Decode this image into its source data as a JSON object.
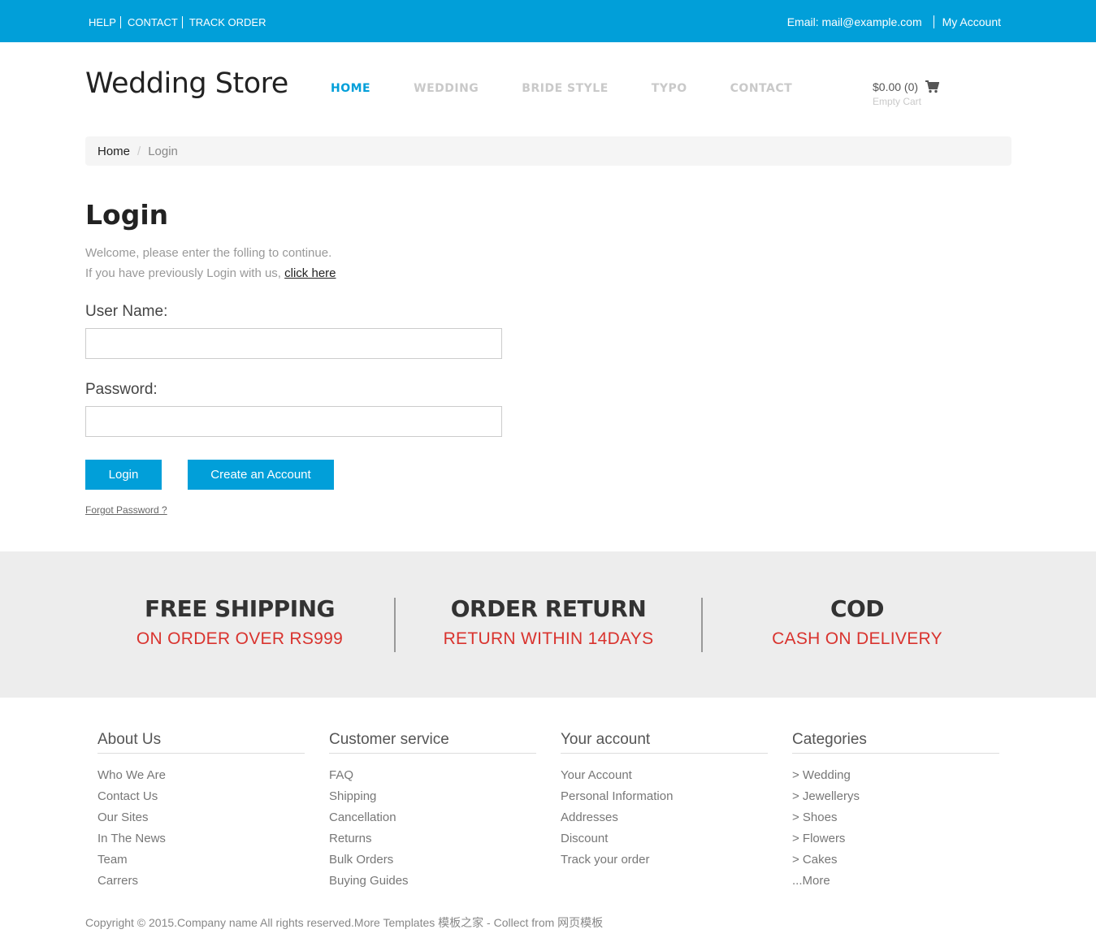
{
  "topbar": {
    "links": [
      "HELP",
      "CONTACT",
      "TRACK ORDER"
    ],
    "email": "Email: mail@example.com",
    "account": "My Account"
  },
  "header": {
    "logo": "Wedding Store",
    "nav": [
      "HOME",
      "WEDDING",
      "BRIDE STYLE",
      "TYPO",
      "CONTACT"
    ],
    "cart_amount": "$0.00 (0)",
    "cart_status": "Empty Cart",
    "cart_icon": "shopping-cart-icon"
  },
  "breadcrumb": {
    "home": "Home",
    "divider": "/",
    "current": "Login"
  },
  "login": {
    "title": "Login",
    "welcome_line1": "Welcome, please enter the folling to continue.",
    "welcome_line2": "If you have previously Login with us,",
    "click_here": "click here",
    "username_label": "User Name:",
    "username_value": "",
    "password_label": "Password:",
    "password_value": "",
    "login_button": "Login",
    "create_button": "Create an Account",
    "forgot": "Forgot Password ?"
  },
  "features": [
    {
      "title": "FREE SHIPPING",
      "subtitle": "ON ORDER OVER RS999"
    },
    {
      "title": "ORDER RETURN",
      "subtitle": "RETURN WITHIN 14DAYS"
    },
    {
      "title": "COD",
      "subtitle": "CASH ON DELIVERY"
    }
  ],
  "footer": {
    "columns": [
      {
        "heading": "About Us",
        "items": [
          "Who We Are",
          "Contact Us",
          "Our Sites",
          "In The News",
          "Team",
          "Carrers"
        ]
      },
      {
        "heading": "Customer service",
        "items": [
          "FAQ",
          "Shipping",
          "Cancellation",
          "Returns",
          "Bulk Orders",
          "Buying Guides"
        ]
      },
      {
        "heading": "Your account",
        "items": [
          "Your Account",
          "Personal Information",
          "Addresses",
          "Discount",
          "Track your order"
        ]
      },
      {
        "heading": "Categories",
        "items": [
          "> Wedding",
          "> Jewellerys",
          "> Shoes",
          "> Flowers",
          "> Cakes",
          "...More"
        ]
      }
    ],
    "copyright": "Copyright © 2015.Company name All rights reserved.More Templates 模板之家 - Collect from 网页模板"
  },
  "colors": {
    "accent": "#019fd9",
    "feature_subtitle": "#d9332e",
    "features_bg": "#ededed"
  }
}
